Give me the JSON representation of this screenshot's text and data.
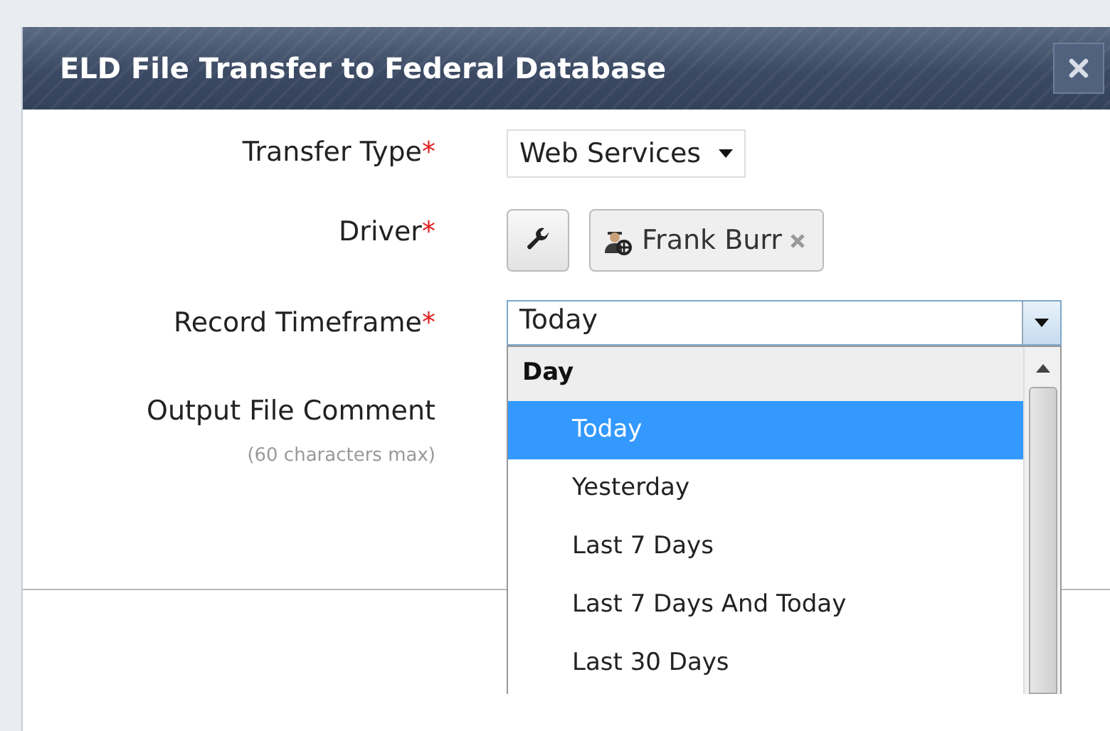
{
  "dialog": {
    "title": "ELD File Transfer to Federal Database"
  },
  "fields": [
    {
      "kind": "select",
      "label": "Transfer Type",
      "required_mark": "*",
      "value": "Web Services"
    },
    {
      "kind": "tokens",
      "label": "Driver",
      "required_mark": "*",
      "tokens": [
        "Frank Burr"
      ]
    },
    {
      "kind": "combo",
      "label": "Record Timeframe",
      "required_mark": "*",
      "value": "Today",
      "expanded": true
    },
    {
      "kind": "comment",
      "label": "Output File Comment",
      "hint": "(60 characters max)"
    }
  ],
  "dropdown": {
    "group": "Day",
    "options": [
      {
        "label": "Today",
        "selected": true
      },
      {
        "label": "Yesterday",
        "selected": false
      },
      {
        "label": "Last 7 Days",
        "selected": false
      },
      {
        "label": "Last 7 Days And Today",
        "selected": false
      },
      {
        "label": "Last 30 Days",
        "selected": false
      }
    ]
  }
}
